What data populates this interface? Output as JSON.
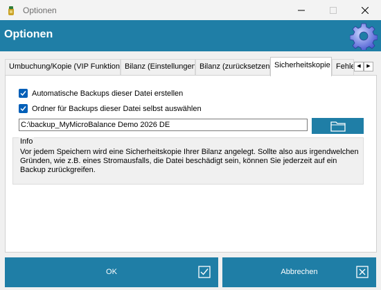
{
  "window": {
    "title": "Optionen"
  },
  "header": {
    "title": "Optionen"
  },
  "tabs": [
    {
      "label": "Umbuchung/Kopie (VIP Funktion)",
      "active": false
    },
    {
      "label": "Bilanz (Einstellungen)",
      "active": false
    },
    {
      "label": "Bilanz (zurücksetzen)",
      "active": false
    },
    {
      "label": "Sicherheitskopie",
      "active": true
    },
    {
      "label": "Fehle",
      "active": false
    }
  ],
  "tab_scroll": {
    "left": "◀",
    "right": "▶"
  },
  "options": {
    "auto_backup": {
      "label": "Automatische Backups dieser Datei erstellen",
      "checked": true
    },
    "custom_folder": {
      "label": "Ordner für Backups dieser Datei selbst auswählen",
      "checked": true
    }
  },
  "backup_path": {
    "value": "C:\\backup_MyMicroBalance Demo 2026 DE"
  },
  "info": {
    "title": "Info",
    "text": "Vor jedem Speichern wird eine Sicherheitskopie Ihrer Bilanz angelegt. Sollte also aus irgendwelchen Gründen, wie z.B. eines Stromausfalls, die Datei beschädigt sein, können Sie jederzeit auf ein Backup zurückgreifen."
  },
  "buttons": {
    "ok": "OK",
    "cancel": "Abbrechen"
  },
  "icons": {
    "app": "app-icon",
    "settings": "gear-icon",
    "folder": "folder-icon",
    "confirm": "checkbox-check-icon",
    "cancel": "checkbox-x-icon"
  },
  "colors": {
    "accent": "#1f7ea6",
    "checkbox": "#005fb8"
  }
}
